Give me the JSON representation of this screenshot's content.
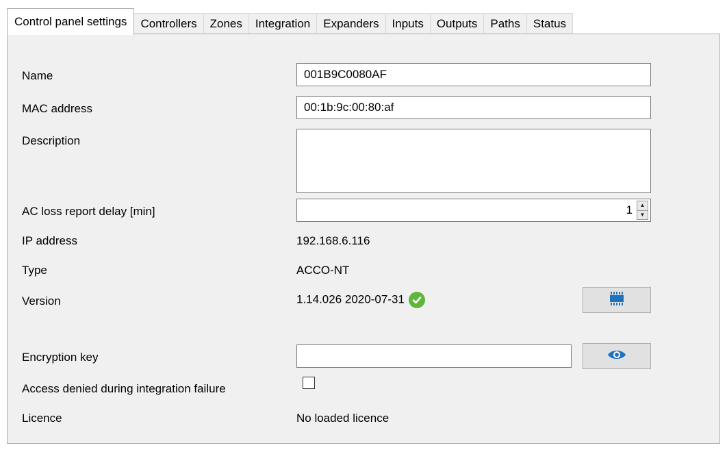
{
  "tabs": [
    {
      "label": "Control panel settings"
    },
    {
      "label": "Controllers"
    },
    {
      "label": "Zones"
    },
    {
      "label": "Integration"
    },
    {
      "label": "Expanders"
    },
    {
      "label": "Inputs"
    },
    {
      "label": "Outputs"
    },
    {
      "label": "Paths"
    },
    {
      "label": "Status"
    }
  ],
  "active_tab": "Control panel settings",
  "form": {
    "name": {
      "label": "Name",
      "value": "001B9C0080AF"
    },
    "mac": {
      "label": "MAC address",
      "value": "00:1b:9c:00:80:af"
    },
    "description": {
      "label": "Description",
      "value": ""
    },
    "ac_loss": {
      "label": "AC loss report delay [min]",
      "value": "1"
    },
    "ip": {
      "label": "IP address",
      "value": "192.168.6.116"
    },
    "type": {
      "label": "Type",
      "value": "ACCO-NT"
    },
    "version": {
      "label": "Version",
      "value": "1.14.026 2020-07-31",
      "status_icon": "check-circle-icon",
      "status_color": "#5fb63c",
      "update_icon": "firmware-chip-icon"
    },
    "encryption_key": {
      "label": "Encryption key",
      "value": "",
      "reveal_icon": "eye-icon"
    },
    "access_denied": {
      "label": "Access denied during integration failure",
      "checked": false
    },
    "licence": {
      "label": "Licence",
      "value": "No loaded licence"
    }
  },
  "colors": {
    "panel_bg": "#f0f0f0",
    "accent_icon": "#1e73be",
    "ok_green": "#5fb63c"
  }
}
